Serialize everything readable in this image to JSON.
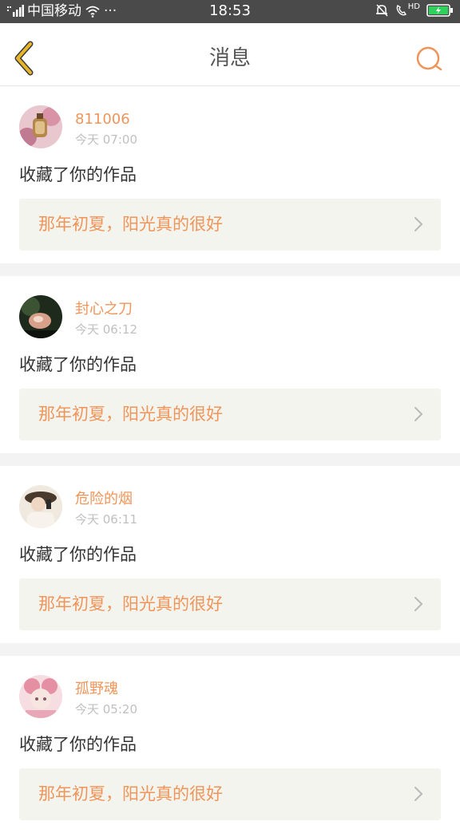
{
  "status_bar": {
    "carrier": "中国移动",
    "time": "18:53",
    "dots": "···",
    "hd_label": "HD"
  },
  "header": {
    "title": "消息"
  },
  "notifications": [
    {
      "username": "811006",
      "time": "今天 07:00",
      "action": "收藏了你的作品",
      "work_title": "那年初夏，阳光真的很好"
    },
    {
      "username": "封心之刀",
      "time": "今天 06:12",
      "action": "收藏了你的作品",
      "work_title": "那年初夏，阳光真的很好"
    },
    {
      "username": "危险的烟",
      "time": "今天 06:11",
      "action": "收藏了你的作品",
      "work_title": "那年初夏，阳光真的很好"
    },
    {
      "username": "孤野魂",
      "time": "今天 05:20",
      "action": "收藏了你的作品",
      "work_title": "那年初夏，阳光真的很好"
    }
  ],
  "colors": {
    "accent": "#f0955a",
    "back_icon": "#e7b52a",
    "status_bar_bg": "#4a4a4a",
    "link_bg": "#f4f4ee",
    "battery_fill": "#2fd05b"
  }
}
